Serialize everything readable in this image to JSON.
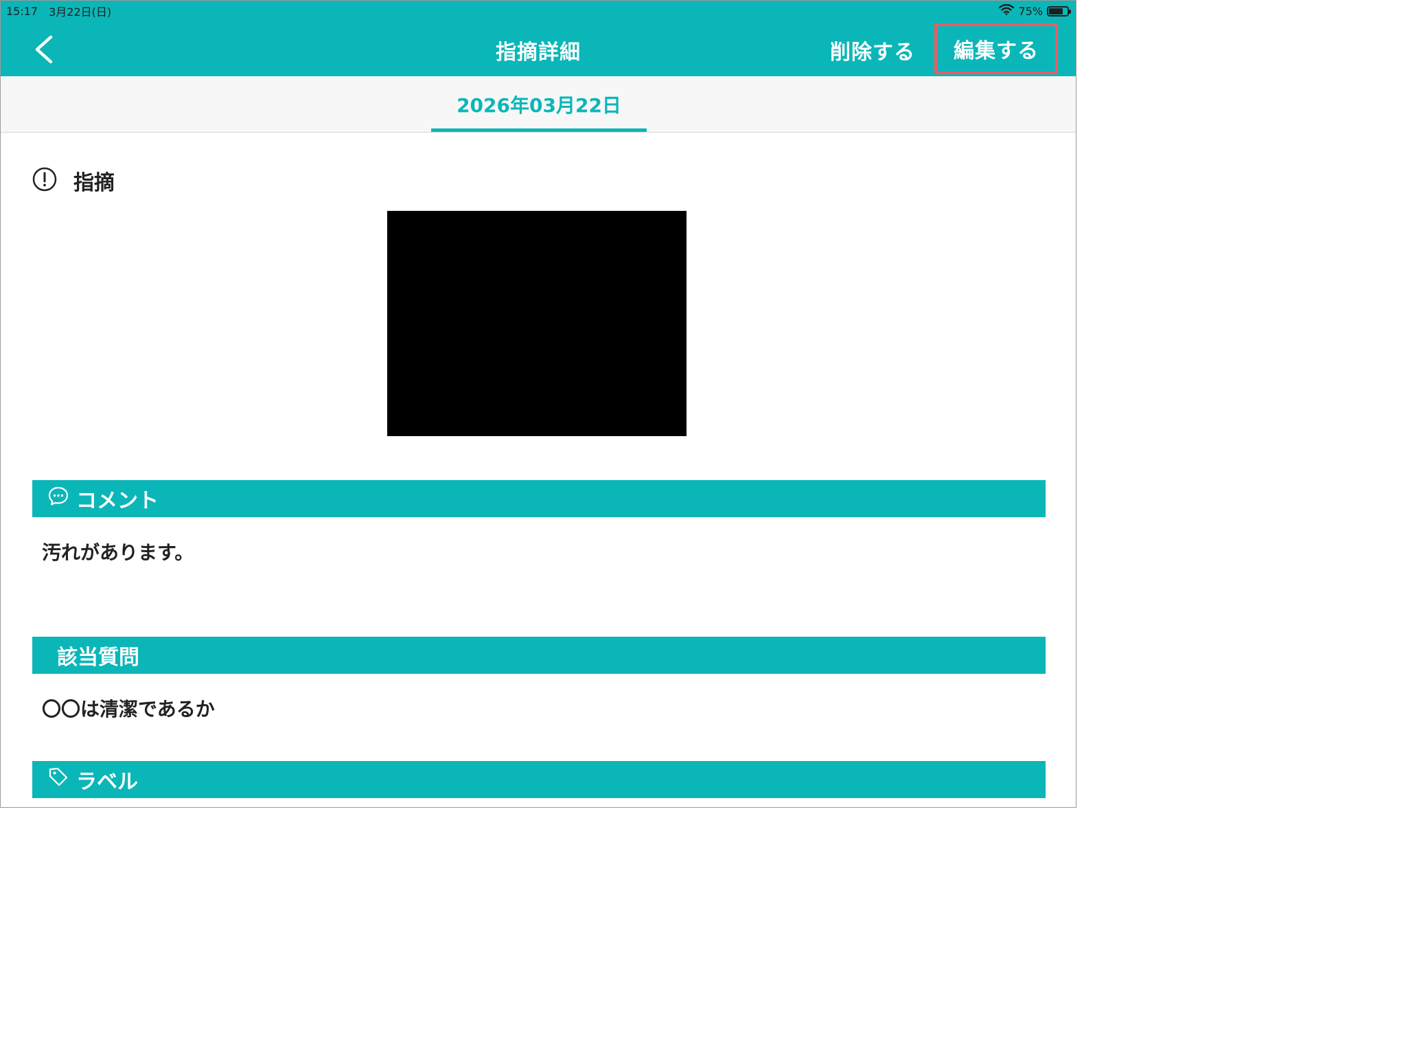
{
  "status_bar": {
    "time": "15:17",
    "date": "3月22日(日)",
    "battery_percent_label": "75%",
    "battery_level": 0.75
  },
  "nav": {
    "title": "指摘詳細",
    "delete_label": "削除する",
    "edit_label": "編集する"
  },
  "date_tab": {
    "label": "2026年03月22日"
  },
  "issue": {
    "title": "指摘",
    "icon": "exclamation-circle-icon"
  },
  "sections": {
    "comment": {
      "header": "コメント",
      "icon": "chat-bubble-icon",
      "body": "汚れがあります。"
    },
    "question": {
      "header": "該当質問",
      "body": "〇〇は清潔であるか"
    },
    "label": {
      "header": "ラベル",
      "icon": "tag-icon"
    }
  },
  "colors": {
    "accent": "#0bb6b8",
    "highlight_border": "#ef5a66"
  }
}
